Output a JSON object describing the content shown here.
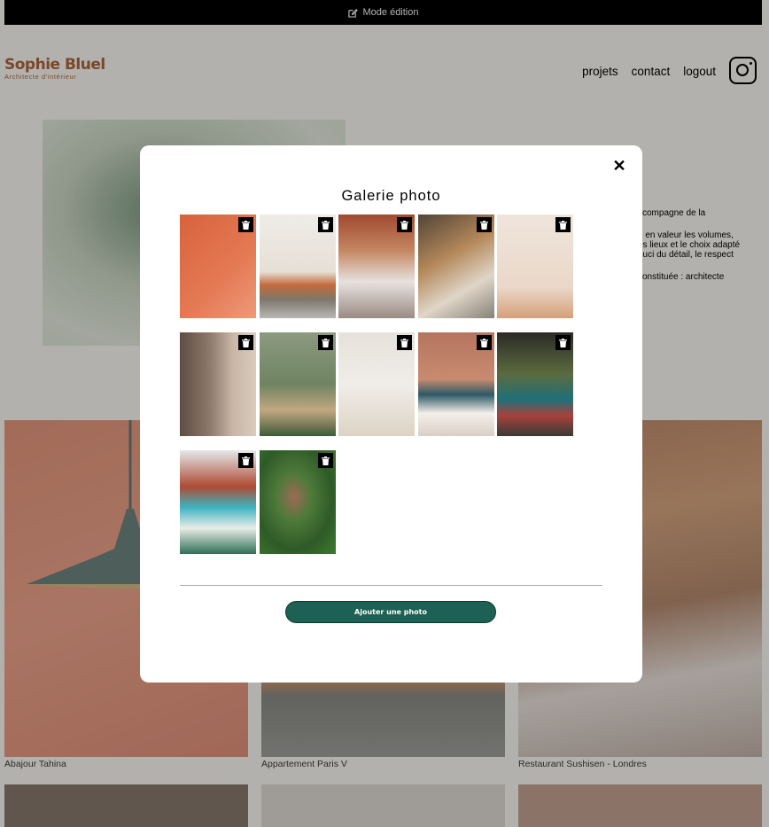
{
  "edit_bar": {
    "label": "Mode édition"
  },
  "header": {
    "logo_name": "Sophie Bluel",
    "logo_subtitle": "Architecte d'intérieur",
    "nav": [
      "projets",
      "contact",
      "logout"
    ]
  },
  "intro": {
    "text_lines": [
      "ccompagne de la",
      "e en valeur les volumes,",
      "es lieux et le choix adapté",
      "ouci du détail, le respect",
      "constituée : architecte"
    ]
  },
  "gallery": [
    {
      "caption": "Abajour Tahina"
    },
    {
      "caption": "Appartement Paris V"
    },
    {
      "caption": "Restaurant Sushisen - Londres"
    }
  ],
  "modal": {
    "title": "Galerie photo",
    "add_button": "Ajouter une photo",
    "close_icon": "close-icon",
    "photo_count": 12,
    "delete_icon": "trash-icon"
  },
  "colors": {
    "brand": "#b1663c",
    "button": "#1d6154"
  }
}
